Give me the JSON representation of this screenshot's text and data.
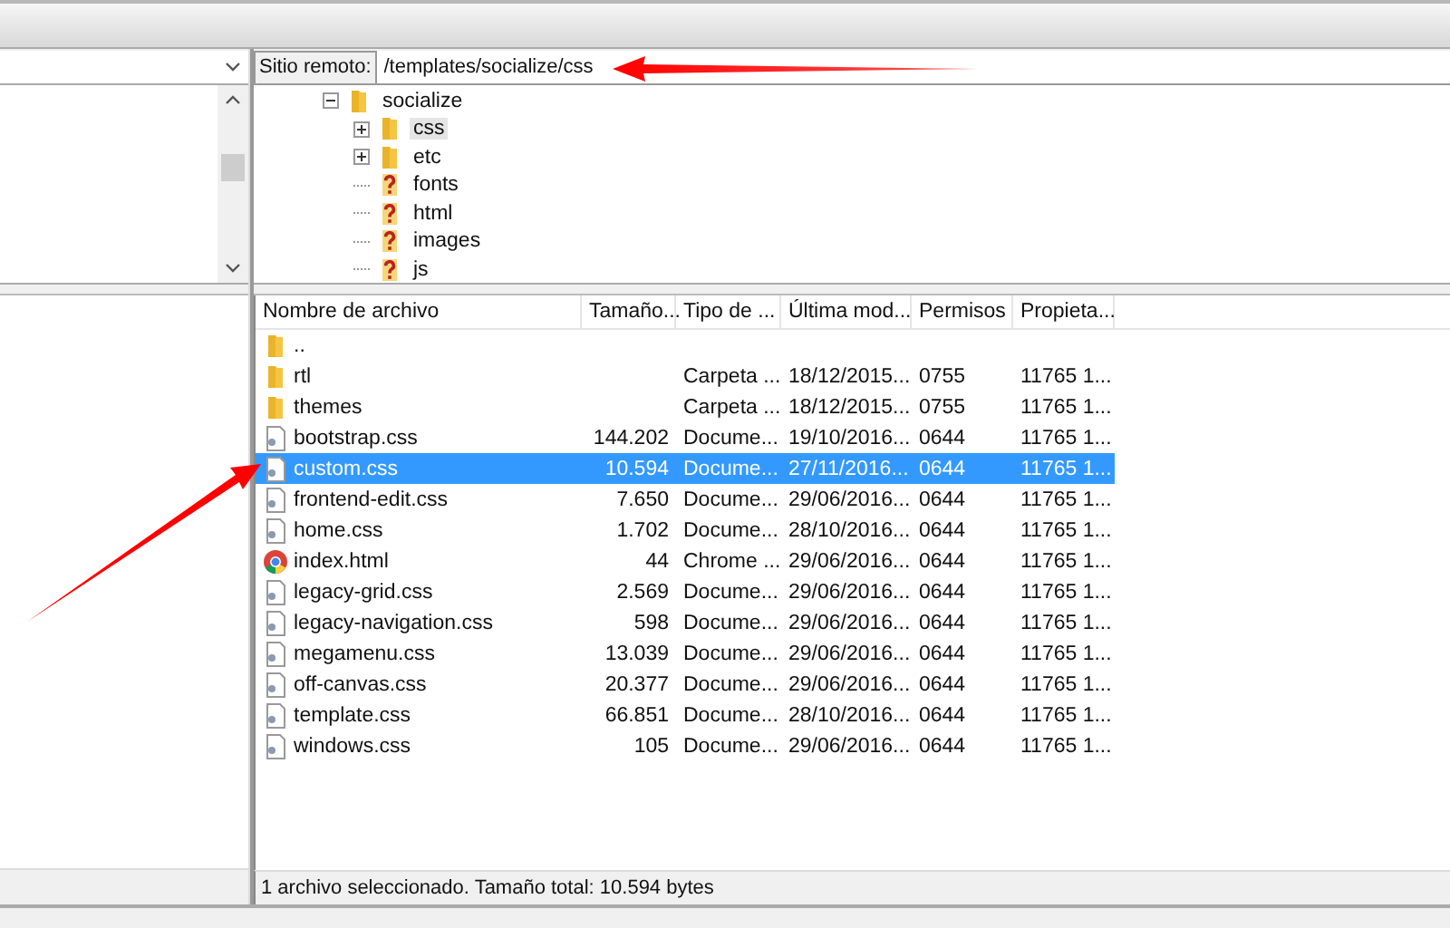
{
  "remote_path": {
    "label": "Sitio remoto:",
    "value": "/templates/socialize/css"
  },
  "remote_tree": [
    {
      "name": "socialize",
      "kind": "folder",
      "expanded": true,
      "selected": false,
      "children": [
        {
          "name": "css",
          "kind": "folder",
          "expanded": false,
          "selected": true
        },
        {
          "name": "etc",
          "kind": "folder",
          "expanded": false,
          "selected": false
        },
        {
          "name": "fonts",
          "kind": "unknown",
          "selected": false
        },
        {
          "name": "html",
          "kind": "unknown",
          "selected": false
        },
        {
          "name": "images",
          "kind": "unknown",
          "selected": false
        },
        {
          "name": "js",
          "kind": "unknown",
          "selected": false
        }
      ]
    }
  ],
  "file_list": {
    "columns": [
      "Nombre de archivo",
      "Tamaño...",
      "Tipo de ...",
      "Última mod...",
      "Permisos",
      "Propieta..."
    ],
    "rows": [
      {
        "kind": "folder",
        "selected": false,
        "cells": [
          "..",
          "",
          "",
          "",
          "",
          ""
        ]
      },
      {
        "kind": "folder",
        "selected": false,
        "cells": [
          "rtl",
          "",
          "Carpeta ...",
          "18/12/2015...",
          "0755",
          "11765 1..."
        ]
      },
      {
        "kind": "folder",
        "selected": false,
        "cells": [
          "themes",
          "",
          "Carpeta ...",
          "18/12/2015...",
          "0755",
          "11765 1..."
        ]
      },
      {
        "kind": "file",
        "selected": false,
        "cells": [
          "bootstrap.css",
          "144.202",
          "Docume...",
          "19/10/2016...",
          "0644",
          "11765 1..."
        ]
      },
      {
        "kind": "file",
        "selected": true,
        "cells": [
          "custom.css",
          "10.594",
          "Docume...",
          "27/11/2016...",
          "0644",
          "11765 1..."
        ]
      },
      {
        "kind": "file",
        "selected": false,
        "cells": [
          "frontend-edit.css",
          "7.650",
          "Docume...",
          "29/06/2016...",
          "0644",
          "11765 1..."
        ]
      },
      {
        "kind": "file",
        "selected": false,
        "cells": [
          "home.css",
          "1.702",
          "Docume...",
          "28/10/2016...",
          "0644",
          "11765 1..."
        ]
      },
      {
        "kind": "browser",
        "selected": false,
        "cells": [
          "index.html",
          "44",
          "Chrome ...",
          "29/06/2016...",
          "0644",
          "11765 1..."
        ]
      },
      {
        "kind": "file",
        "selected": false,
        "cells": [
          "legacy-grid.css",
          "2.569",
          "Docume...",
          "29/06/2016...",
          "0644",
          "11765 1..."
        ]
      },
      {
        "kind": "file",
        "selected": false,
        "cells": [
          "legacy-navigation.css",
          "598",
          "Docume...",
          "29/06/2016...",
          "0644",
          "11765 1..."
        ]
      },
      {
        "kind": "file",
        "selected": false,
        "cells": [
          "megamenu.css",
          "13.039",
          "Docume...",
          "29/06/2016...",
          "0644",
          "11765 1..."
        ]
      },
      {
        "kind": "file",
        "selected": false,
        "cells": [
          "off-canvas.css",
          "20.377",
          "Docume...",
          "29/06/2016...",
          "0644",
          "11765 1..."
        ]
      },
      {
        "kind": "file",
        "selected": false,
        "cells": [
          "template.css",
          "66.851",
          "Docume...",
          "28/10/2016...",
          "0644",
          "11765 1..."
        ]
      },
      {
        "kind": "file",
        "selected": false,
        "cells": [
          "windows.css",
          "105",
          "Docume...",
          "29/06/2016...",
          "0644",
          "11765 1..."
        ]
      }
    ]
  },
  "status_bar": {
    "remote": "1 archivo seleccionado. Tamaño total: 10.594 bytes"
  }
}
